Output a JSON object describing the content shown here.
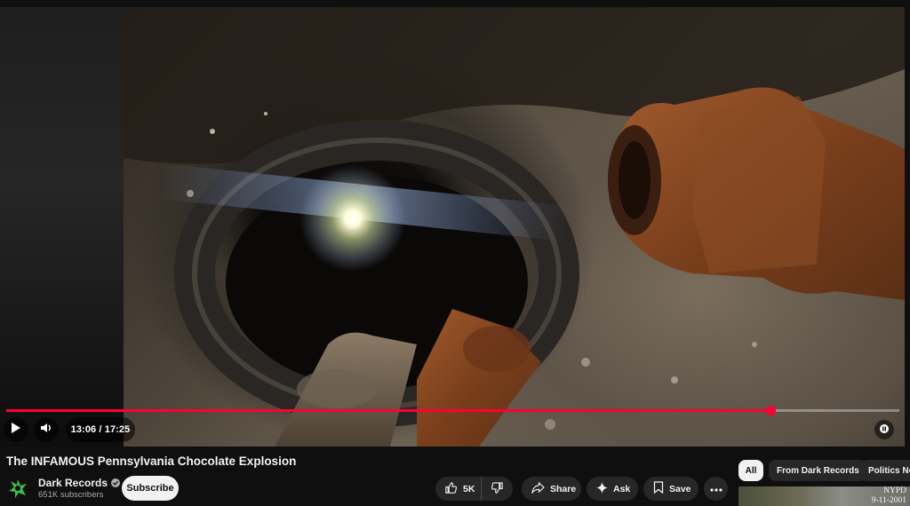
{
  "video": {
    "title": "The INFAMOUS Pennsylvania Chocolate Explosion",
    "current_time": "13:06",
    "duration": "17:25",
    "time_display": "13:06 / 17:25",
    "progress_fraction": 0.856
  },
  "channel": {
    "name": "Dark Records",
    "subscribers": "651K subscribers",
    "verified": true,
    "subscribe_label": "Subscribe"
  },
  "actions": {
    "like_count": "5K",
    "share_label": "Share",
    "ask_label": "Ask",
    "save_label": "Save"
  },
  "chips": [
    "All",
    "From Dark Records",
    "Politics New"
  ],
  "active_chip": "All",
  "recommendation": {
    "thumb_text_line1": "NYPD",
    "thumb_text_line2": "9-11-2001"
  },
  "icons": {
    "play": "play-icon",
    "volume": "volume-icon",
    "like": "thumbs-up-icon",
    "dislike": "thumbs-down-icon",
    "share": "share-arrow-icon",
    "ask": "sparkle-icon",
    "save": "bookmark-icon",
    "more": "more-horizontal-icon"
  },
  "colors": {
    "progress": "#ff0033",
    "background": "#0f0f0f",
    "button": "#272727"
  }
}
